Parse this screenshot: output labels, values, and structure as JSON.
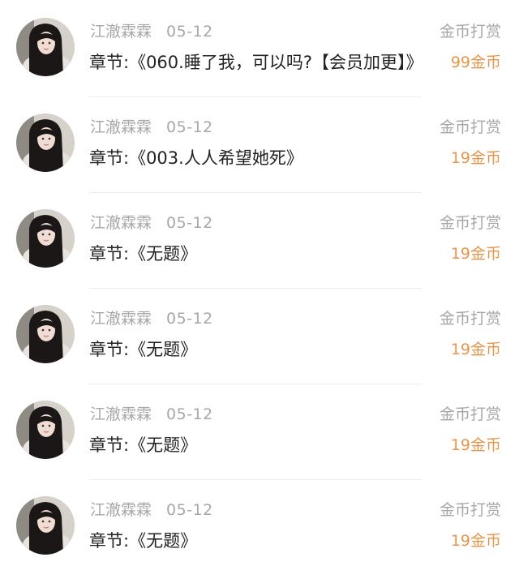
{
  "rows": [
    {
      "user": "江澈霖霖",
      "date": "05-12",
      "chapter": "章节:《060.睡了我，可以吗?【会员加更】》",
      "type": "金币打赏",
      "amount": "99金币"
    },
    {
      "user": "江澈霖霖",
      "date": "05-12",
      "chapter": "章节:《003.人人希望她死》",
      "type": "金币打赏",
      "amount": "19金币"
    },
    {
      "user": "江澈霖霖",
      "date": "05-12",
      "chapter": "章节:《无题》",
      "type": "金币打赏",
      "amount": "19金币"
    },
    {
      "user": "江澈霖霖",
      "date": "05-12",
      "chapter": "章节:《无题》",
      "type": "金币打赏",
      "amount": "19金币"
    },
    {
      "user": "江澈霖霖",
      "date": "05-12",
      "chapter": "章节:《无题》",
      "type": "金币打赏",
      "amount": "19金币"
    },
    {
      "user": "江澈霖霖",
      "date": "05-12",
      "chapter": "章节:《无题》",
      "type": "金币打赏",
      "amount": "19金币"
    }
  ],
  "colors": {
    "accent": "#e8954c",
    "muted": "#a7a7a7",
    "text": "#222222",
    "divider": "#ededed"
  }
}
